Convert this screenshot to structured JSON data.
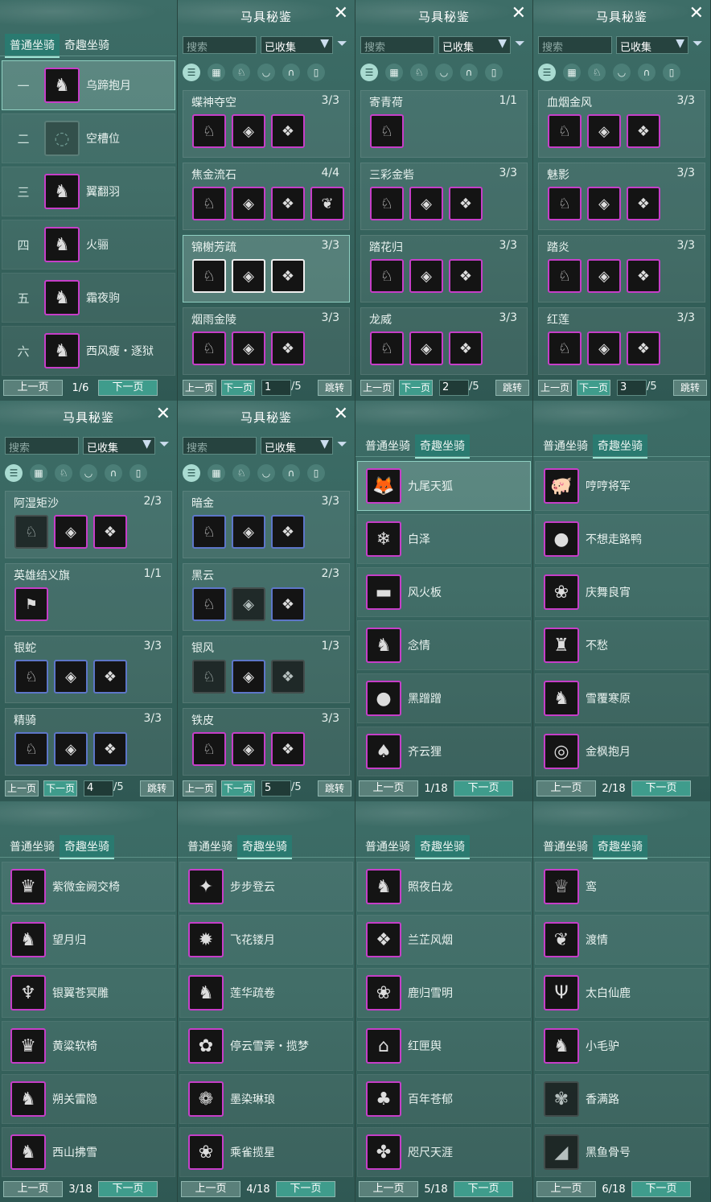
{
  "mount_panels": [
    {
      "tab_normal": "普通坐骑",
      "tab_fun": "奇趣坐骑",
      "active_tab": "normal",
      "rows": [
        {
          "num": "一",
          "name": "乌蹄抱月",
          "icon": "horse-icon"
        },
        {
          "num": "二",
          "name": "空槽位",
          "icon": "empty-slot-icon"
        },
        {
          "num": "三",
          "name": "翼翻羽",
          "icon": "horse-icon"
        },
        {
          "num": "四",
          "name": "火骊",
          "icon": "horse-icon"
        },
        {
          "num": "五",
          "name": "霜夜驹",
          "icon": "horse-icon"
        },
        {
          "num": "六",
          "name": "西风瘦・逐狱",
          "icon": "horse-icon"
        }
      ],
      "prev": "上一页",
      "page": "1/6",
      "next": "下一页"
    },
    {
      "tab_normal": "普通坐骑",
      "tab_fun": "奇趣坐骑",
      "active_tab": "fun",
      "rows": [
        {
          "name": "九尾天狐",
          "icon": "fox-icon"
        },
        {
          "name": "白泽",
          "icon": "beast-icon"
        },
        {
          "name": "风火板",
          "icon": "skateboard-icon"
        },
        {
          "name": "念情",
          "icon": "mount-icon"
        },
        {
          "name": "黑蹭蹭",
          "icon": "mount-icon"
        },
        {
          "name": "齐云狸",
          "icon": "mount-icon"
        }
      ],
      "prev": "上一页",
      "page": "1/18",
      "next": "下一页"
    },
    {
      "tab_normal": "普通坐骑",
      "tab_fun": "奇趣坐骑",
      "active_tab": "fun",
      "rows": [
        {
          "name": "哼哼将军",
          "icon": "pig-icon"
        },
        {
          "name": "不想走路鸭",
          "icon": "duck-icon"
        },
        {
          "name": "庆舞良宵",
          "icon": "lion-icon"
        },
        {
          "name": "不愁",
          "icon": "bird-icon"
        },
        {
          "name": "雪覆寒原",
          "icon": "deer-icon"
        },
        {
          "name": "金枫抱月",
          "icon": "ball-icon"
        }
      ],
      "prev": "上一页",
      "page": "2/18",
      "next": "下一页"
    },
    {
      "tab_normal": "普通坐骑",
      "tab_fun": "奇趣坐骑",
      "active_tab": "fun",
      "rows": [
        {
          "name": "紫微金阙交椅",
          "icon": "chair-icon"
        },
        {
          "name": "望月归",
          "icon": "mount-icon"
        },
        {
          "name": "银翼苍冥雕",
          "icon": "eagle-icon"
        },
        {
          "name": "黄粱软椅",
          "icon": "chair-icon"
        },
        {
          "name": "朔关雷隐",
          "icon": "horse-icon"
        },
        {
          "name": "西山拂雪",
          "icon": "deer-icon"
        }
      ],
      "prev": "上一页",
      "page": "3/18",
      "next": "下一页"
    },
    {
      "tab_normal": "普通坐骑",
      "tab_fun": "奇趣坐骑",
      "active_tab": "fun",
      "rows": [
        {
          "name": "步步登云",
          "icon": "mount-icon"
        },
        {
          "name": "飞花镂月",
          "icon": "wheel-icon"
        },
        {
          "name": "莲华疏卷",
          "icon": "mount-icon"
        },
        {
          "name": "停云雪霁・揽梦",
          "icon": "mount-icon"
        },
        {
          "name": "墨染琳琅",
          "icon": "mount-icon"
        },
        {
          "name": "乘雀揽星",
          "icon": "flower-icon"
        }
      ],
      "prev": "上一页",
      "page": "4/18",
      "next": "下一页"
    },
    {
      "tab_normal": "普通坐骑",
      "tab_fun": "奇趣坐骑",
      "active_tab": "fun",
      "rows": [
        {
          "name": "照夜白龙",
          "icon": "dragon-icon"
        },
        {
          "name": "兰芷风烟",
          "icon": "mount-icon"
        },
        {
          "name": "鹿归雪明",
          "icon": "lion-icon"
        },
        {
          "name": "红匣舆",
          "icon": "sedan-icon"
        },
        {
          "name": "百年苍郁",
          "icon": "mount-icon"
        },
        {
          "name": "咫尺天涯",
          "icon": "mount-icon"
        }
      ],
      "prev": "上一页",
      "page": "5/18",
      "next": "下一页"
    },
    {
      "tab_normal": "普通坐骑",
      "tab_fun": "奇趣坐骑",
      "active_tab": "fun",
      "rows": [
        {
          "name": "鸾",
          "icon": "mount-icon"
        },
        {
          "name": "渡情",
          "icon": "bamboo-icon"
        },
        {
          "name": "太白仙鹿",
          "icon": "antler-icon"
        },
        {
          "name": "小毛驴",
          "icon": "donkey-icon"
        },
        {
          "name": "香满路",
          "icon": "mount-icon"
        },
        {
          "name": "黑鱼骨号",
          "icon": "mount-icon"
        }
      ],
      "prev": "上一页",
      "page": "6/18",
      "next": "下一页"
    }
  ],
  "collection_panels": [
    {
      "title": "马具秘鉴",
      "search_placeholder": "搜索",
      "filter_value": "已收集",
      "page_value": "1",
      "page_total": "/5",
      "prev": "上一页",
      "next": "下一页",
      "jump": "跳转",
      "sets": [
        {
          "name": "蝶神夺空",
          "count": "3/3",
          "items": 3
        },
        {
          "name": "焦金流石",
          "count": "4/4",
          "items": 4
        },
        {
          "name": "锦榭芳疏",
          "count": "3/3",
          "items": 3
        },
        {
          "name": "烟雨金陵",
          "count": "3/3",
          "items": 3
        }
      ]
    },
    {
      "title": "马具秘鉴",
      "search_placeholder": "搜索",
      "filter_value": "已收集",
      "page_value": "2",
      "page_total": "/5",
      "prev": "上一页",
      "next": "下一页",
      "jump": "跳转",
      "sets": [
        {
          "name": "寄青荷",
          "count": "1/1",
          "items": 1
        },
        {
          "name": "三彩金砦",
          "count": "3/3",
          "items": 3
        },
        {
          "name": "踏花归",
          "count": "3/3",
          "items": 3
        },
        {
          "name": "龙威",
          "count": "3/3",
          "items": 3
        }
      ]
    },
    {
      "title": "马具秘鉴",
      "search_placeholder": "搜索",
      "filter_value": "已收集",
      "page_value": "3",
      "page_total": "/5",
      "prev": "上一页",
      "next": "下一页",
      "jump": "跳转",
      "sets": [
        {
          "name": "血烟金风",
          "count": "3/3",
          "items": 3
        },
        {
          "name": "魅影",
          "count": "3/3",
          "items": 3
        },
        {
          "name": "踏炎",
          "count": "3/3",
          "items": 3
        },
        {
          "name": "红莲",
          "count": "3/3",
          "items": 3
        }
      ]
    },
    {
      "title": "马具秘鉴",
      "search_placeholder": "搜索",
      "filter_value": "已收集",
      "page_value": "4",
      "page_total": "/5",
      "prev": "上一页",
      "next": "下一页",
      "jump": "跳转",
      "sets": [
        {
          "name": "阿湿矩沙",
          "count": "2/3",
          "items": 3
        },
        {
          "name": "英雄结义旗",
          "count": "1/1",
          "items": 1
        },
        {
          "name": "银蛇",
          "count": "3/3",
          "items": 3
        },
        {
          "name": "精骑",
          "count": "3/3",
          "items": 3
        }
      ]
    },
    {
      "title": "马具秘鉴",
      "search_placeholder": "搜索",
      "filter_value": "已收集",
      "page_value": "5",
      "page_total": "/5",
      "prev": "上一页",
      "next": "下一页",
      "jump": "跳转",
      "sets": [
        {
          "name": "暗金",
          "count": "3/3",
          "items": 3
        },
        {
          "name": "黑云",
          "count": "2/3",
          "items": 3
        },
        {
          "name": "银风",
          "count": "1/3",
          "items": 3
        },
        {
          "name": "铁皮",
          "count": "3/3",
          "items": 3
        }
      ]
    }
  ]
}
